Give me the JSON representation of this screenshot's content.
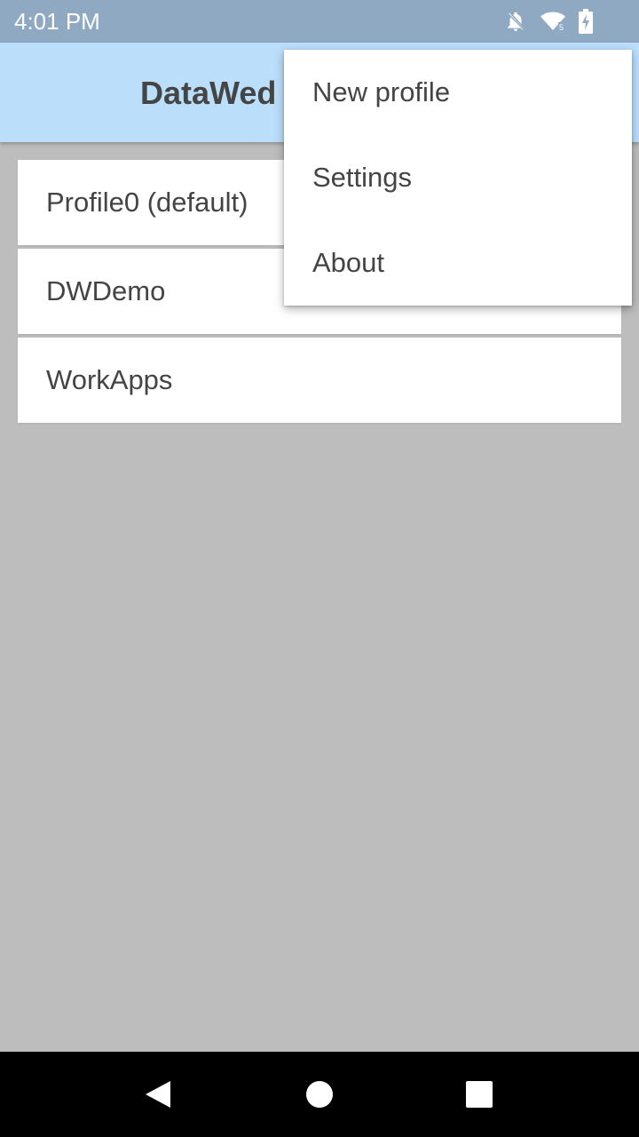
{
  "status_bar": {
    "time": "4:01 PM",
    "icons": [
      "bell-off-icon",
      "wifi-icon",
      "battery-charging-icon"
    ]
  },
  "app_bar": {
    "title": "DataWed"
  },
  "profiles": [
    {
      "label": "Profile0 (default)"
    },
    {
      "label": "DWDemo"
    },
    {
      "label": "WorkApps"
    }
  ],
  "menu": {
    "items": [
      {
        "label": "New profile"
      },
      {
        "label": "Settings"
      },
      {
        "label": "About"
      }
    ]
  },
  "nav_bar": {
    "buttons": [
      "back-icon",
      "home-icon",
      "recents-icon"
    ]
  },
  "colors": {
    "status_bar": "#8ea9c1",
    "app_bar": "#bbdefb",
    "background": "#bdbdbd",
    "nav_bar": "#000000"
  }
}
